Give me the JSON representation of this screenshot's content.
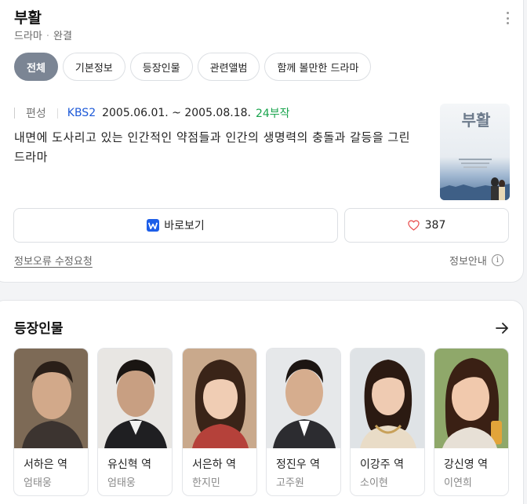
{
  "drama": {
    "title": "부활",
    "genre": "드라마",
    "status": "완결"
  },
  "tabs": [
    {
      "label": "전체",
      "active": true
    },
    {
      "label": "기본정보",
      "active": false
    },
    {
      "label": "등장인물",
      "active": false
    },
    {
      "label": "관련앨범",
      "active": false
    },
    {
      "label": "함께 볼만한 드라마",
      "active": false
    }
  ],
  "meta": {
    "label": "편성",
    "network": "KBS2",
    "dates": "2005.06.01. ~ 2005.08.18.",
    "episodes": "24부작"
  },
  "description": "내면에 도사리고 있는 인간적인 약점들과 인간의 생명력의 충돌과 갈등을 그린 드라마",
  "poster": {
    "title_text": "부활"
  },
  "actions": {
    "watch_label": "바로보기",
    "like_count": "387"
  },
  "footer": {
    "error_report": "정보오류 수정요청",
    "info_guide": "정보안내"
  },
  "cast_section": {
    "title": "등장인물",
    "members": [
      {
        "role": "서하은 역",
        "actor": "엄태웅"
      },
      {
        "role": "유신혁 역",
        "actor": "엄태웅"
      },
      {
        "role": "서은하 역",
        "actor": "한지민"
      },
      {
        "role": "정진우 역",
        "actor": "고주원"
      },
      {
        "role": "이강주 역",
        "actor": "소이현"
      },
      {
        "role": "강신영 역",
        "actor": "이연희"
      }
    ]
  },
  "colors": {
    "accent_blue": "#1e5ad8",
    "episodes_green": "#19a44d",
    "active_tab": "#7b8594",
    "heart": "#e84b4b"
  }
}
